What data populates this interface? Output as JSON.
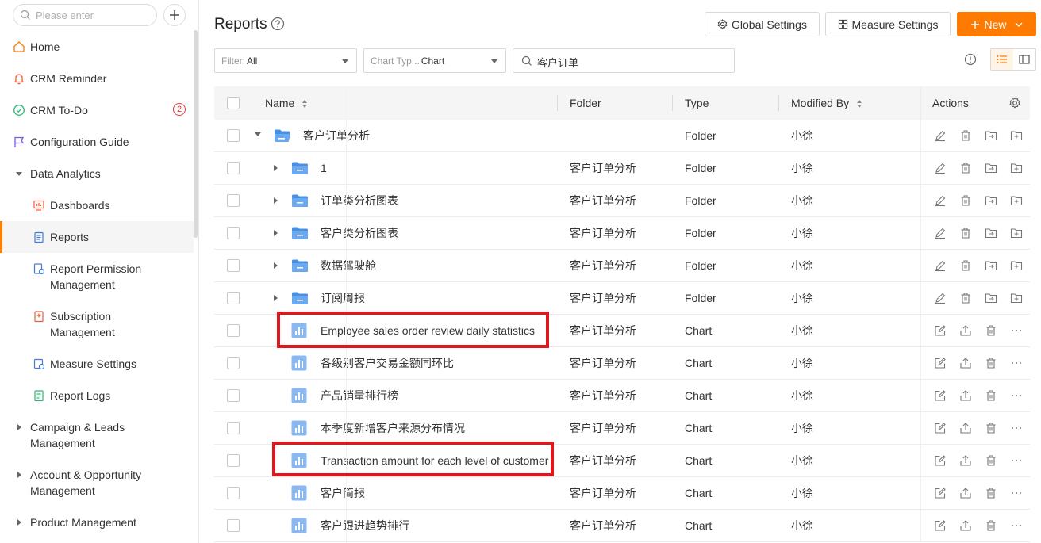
{
  "sidebar": {
    "search_placeholder": "Please enter",
    "items": [
      {
        "label": "Home"
      },
      {
        "label": "CRM Reminder"
      },
      {
        "label": "CRM To-Do",
        "badge": "2"
      },
      {
        "label": "Configuration Guide"
      },
      {
        "label": "Data Analytics"
      },
      {
        "label": "Dashboards"
      },
      {
        "label": "Reports"
      },
      {
        "label": "Report Permission Management"
      },
      {
        "label": "Subscription Management"
      },
      {
        "label": "Measure Settings"
      },
      {
        "label": "Report Logs"
      },
      {
        "label": "Campaign & Leads Management"
      },
      {
        "label": "Account & Opportunity Management"
      },
      {
        "label": "Product Management"
      }
    ]
  },
  "header": {
    "title": "Reports",
    "global_settings": "Global Settings",
    "measure_settings": "Measure Settings",
    "new_label": "New"
  },
  "filters": {
    "filter_key": "Filter:",
    "filter_value": "All",
    "chart_type_key": "Chart Typ...",
    "chart_type_value": "Chart",
    "search_value": "客户订单"
  },
  "table": {
    "columns": {
      "name": "Name",
      "folder": "Folder",
      "type": "Type",
      "modified_by": "Modified By",
      "actions": "Actions"
    },
    "rows": [
      {
        "name": "客户订单分析",
        "folder": "",
        "type": "Folder",
        "modified_by": "小徐"
      },
      {
        "name": "1",
        "folder": "客户订单分析",
        "type": "Folder",
        "modified_by": "小徐"
      },
      {
        "name": "订单类分析图表",
        "folder": "客户订单分析",
        "type": "Folder",
        "modified_by": "小徐"
      },
      {
        "name": "客户类分析图表",
        "folder": "客户订单分析",
        "type": "Folder",
        "modified_by": "小徐"
      },
      {
        "name": "数据驾驶舱",
        "folder": "客户订单分析",
        "type": "Folder",
        "modified_by": "小徐"
      },
      {
        "name": "订阅周报",
        "folder": "客户订单分析",
        "type": "Folder",
        "modified_by": "小徐"
      },
      {
        "name": "Employee sales order review daily statistics",
        "folder": "客户订单分析",
        "type": "Chart",
        "modified_by": "小徐"
      },
      {
        "name": "各级别客户交易金额同环比",
        "folder": "客户订单分析",
        "type": "Chart",
        "modified_by": "小徐"
      },
      {
        "name": "产品销量排行榜",
        "folder": "客户订单分析",
        "type": "Chart",
        "modified_by": "小徐"
      },
      {
        "name": "本季度新增客户来源分布情况",
        "folder": "客户订单分析",
        "type": "Chart",
        "modified_by": "小徐"
      },
      {
        "name": "Transaction amount for each level of customer",
        "folder": "客户订单分析",
        "type": "Chart",
        "modified_by": "小徐"
      },
      {
        "name": "客户简报",
        "folder": "客户订单分析",
        "type": "Chart",
        "modified_by": "小徐"
      },
      {
        "name": "客户跟进趋势排行",
        "folder": "客户订单分析",
        "type": "Chart",
        "modified_by": "小徐"
      }
    ]
  },
  "colors": {
    "accent": "#ff7a00",
    "highlight": "#e0181e",
    "folder": "#4a90e2",
    "chart": "#8ab8f0"
  }
}
